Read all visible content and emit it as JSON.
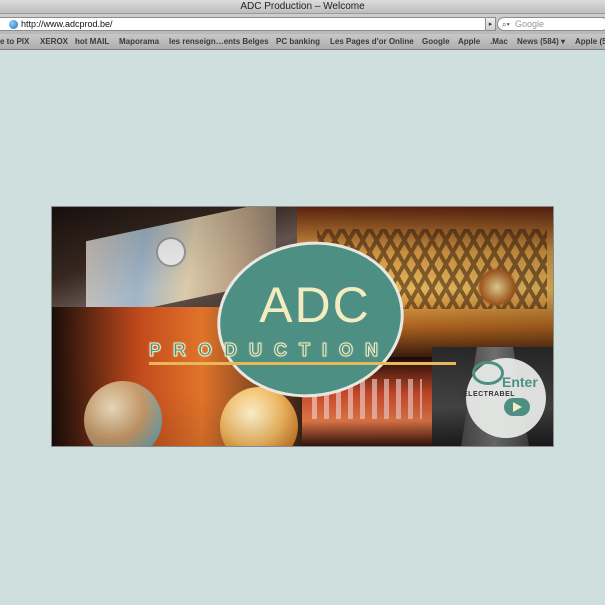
{
  "window": {
    "title": "ADC Production – Welcome"
  },
  "address_bar": {
    "url": "http://www.adcprod.be/"
  },
  "search": {
    "placeholder": "Google"
  },
  "bookmarks": [
    "e to PIX",
    "XEROX",
    "hot MAIL",
    "Maporama",
    "les renseign…ents Belges",
    "PC banking",
    "Les Pages d'or Online",
    "Google",
    "Apple",
    ".Mac",
    "News (584) ▾",
    "Apple (5"
  ],
  "banner": {
    "logo_main": "ADC",
    "logo_sub": "PRODUCTION",
    "sponsor": "ELECTRABEL",
    "enter_label": "Enter"
  },
  "icons": {
    "site": "globe-icon",
    "search": "magnifier-icon",
    "reload": "reload-icon",
    "play": "play-icon",
    "brand": "electrabel-logo-icon"
  },
  "colors": {
    "page_background": "#cfdfdd",
    "logo_teal": "#4e8f83",
    "logo_cream": "#f3ecc0",
    "logo_stripe": "#e7b75a"
  }
}
